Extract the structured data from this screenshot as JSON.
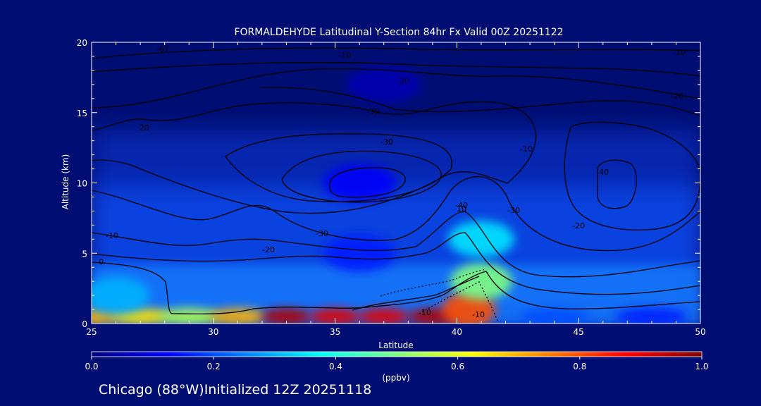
{
  "chart_data": {
    "type": "heatmap",
    "title": "FORMALDEHYDE Latitudinal Y-Section 84hr  Fx Valid 00Z 20251122",
    "xlabel": "Latitude",
    "ylabel": "Altitude (km)",
    "xlim": [
      25,
      50
    ],
    "ylim": [
      0,
      20
    ],
    "x_ticks": [
      25,
      30,
      35,
      40,
      45,
      50
    ],
    "y_ticks": [
      0,
      5,
      10,
      15,
      20
    ],
    "colorbar": {
      "label": "(ppbv)",
      "range": [
        0.0,
        1.0
      ],
      "ticks": [
        "0.0",
        "0.2",
        "0.4",
        "0.6",
        "0.8",
        "1.0"
      ],
      "colors": [
        "#00007f",
        "#0000ff",
        "#0080ff",
        "#00ffff",
        "#80ff80",
        "#ffff00",
        "#ff8000",
        "#ff0000",
        "#7f0000"
      ]
    },
    "concentration_field": [
      {
        "lat": 25,
        "alt": 0.5,
        "value": 0.7
      },
      {
        "lat": 27,
        "alt": 0.5,
        "value": 0.65
      },
      {
        "lat": 29,
        "alt": 0.5,
        "value": 0.55
      },
      {
        "lat": 31,
        "alt": 0.5,
        "value": 0.7
      },
      {
        "lat": 33,
        "alt": 0.5,
        "value": 0.95
      },
      {
        "lat": 35,
        "alt": 0.5,
        "value": 0.9
      },
      {
        "lat": 37,
        "alt": 0.5,
        "value": 0.9
      },
      {
        "lat": 39,
        "alt": 0.5,
        "value": 0.95
      },
      {
        "lat": 40.5,
        "alt": 1.0,
        "value": 0.8
      },
      {
        "lat": 41,
        "alt": 3.0,
        "value": 0.5
      },
      {
        "lat": 41,
        "alt": 6.0,
        "value": 0.35
      },
      {
        "lat": 44,
        "alt": 0.5,
        "value": 0.2
      },
      {
        "lat": 48,
        "alt": 0.5,
        "value": 0.15
      },
      {
        "lat": 26,
        "alt": 2.0,
        "value": 0.3
      },
      {
        "lat": 36,
        "alt": 5.0,
        "value": 0.15
      },
      {
        "lat": 36,
        "alt": 10.0,
        "value": 0.12
      },
      {
        "lat": 37,
        "alt": 17.0,
        "value": 0.05
      }
    ],
    "contour_labels": [
      "-67",
      "-10",
      "-10",
      "-20",
      "-30",
      "-20",
      "20",
      "-30",
      "-40",
      "-40",
      "-30",
      "-20",
      "-10",
      "0",
      "10",
      "-30",
      "-20",
      "-10",
      "10",
      "-10"
    ]
  },
  "footer": {
    "text": "Chicago (88°W)Initialized 12Z 20251118"
  }
}
